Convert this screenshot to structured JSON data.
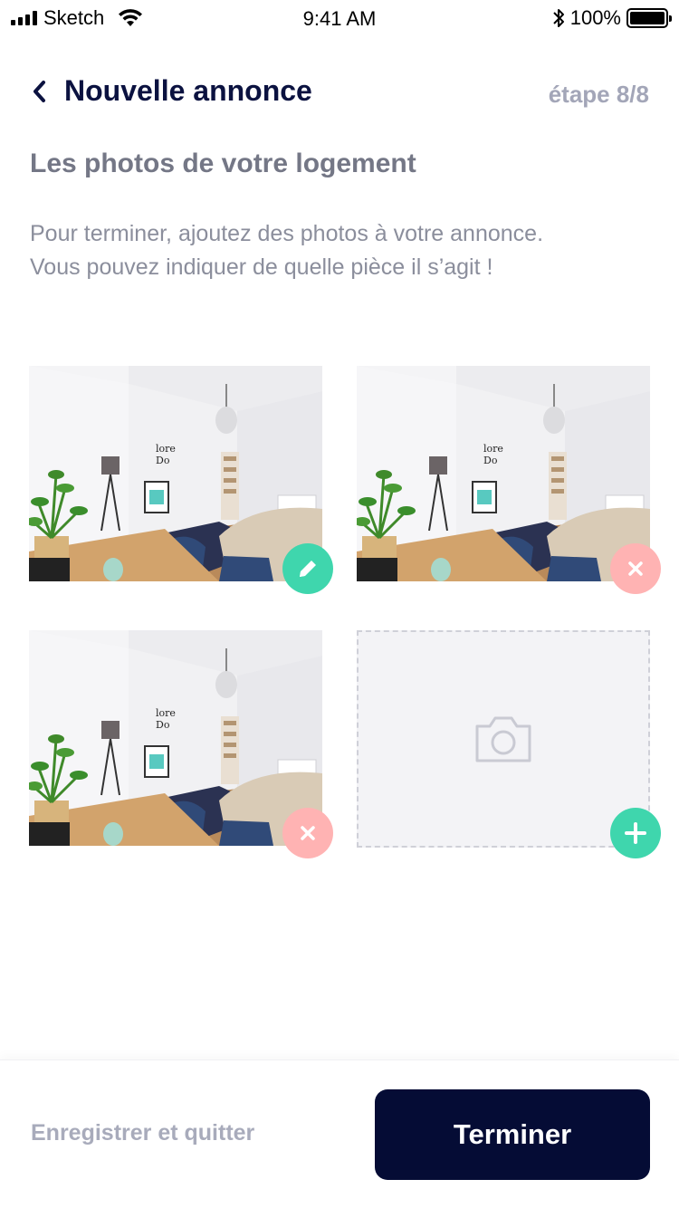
{
  "status_bar": {
    "carrier": "Sketch",
    "time": "9:41 AM",
    "battery": "100%",
    "battery_level": 1.0
  },
  "header": {
    "title": "Nouvelle annonce",
    "step": "étape 8/8",
    "back_icon": "chevron-left-icon"
  },
  "section": {
    "title": "Les photos de votre logement",
    "description_line1": "Pour terminer, ajoutez des photos à votre annonce.",
    "description_line2": "Vous pouvez indiquer de quelle pièce il s’agit !"
  },
  "photos": [
    {
      "action_icon": "pencil-icon",
      "action_color": "#3fd6ad"
    },
    {
      "action_icon": "close-icon",
      "action_color": "#ffb3b3"
    },
    {
      "action_icon": "close-icon",
      "action_color": "#ffb3b3"
    }
  ],
  "empty_slot": {
    "icon": "camera-icon",
    "action_icon": "plus-icon",
    "action_color": "#3fd6ad"
  },
  "footer": {
    "save_label": "Enregistrer et quitter",
    "finish_label": "Terminer"
  },
  "colors": {
    "primary_dark": "#050c35",
    "accent_green": "#3fd6ad",
    "accent_pink": "#ffb3b3",
    "muted_text": "#8b8e9c"
  }
}
